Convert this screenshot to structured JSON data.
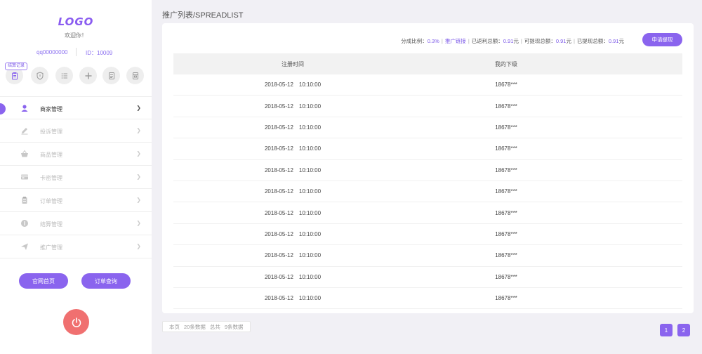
{
  "sidebar": {
    "logo": "LOGO",
    "welcome": "欢迎你！",
    "qq": "qq00000000",
    "uid": "ID：10009",
    "quick_badge": "结算记录",
    "quick_icons": [
      "clipboard-icon",
      "shield-icon",
      "list-icon",
      "plus-icon",
      "document-icon",
      "archive-icon"
    ],
    "menu": [
      {
        "label": "商家管理",
        "icon": "user-icon",
        "active": true
      },
      {
        "label": "投诉管理",
        "icon": "pencil-icon"
      },
      {
        "label": "商品管理",
        "icon": "basket-icon"
      },
      {
        "label": "卡密管理",
        "icon": "card-icon"
      },
      {
        "label": "订单管理",
        "icon": "clipboard-icon"
      },
      {
        "label": "结算管理",
        "icon": "coin-icon"
      },
      {
        "label": "推广管理",
        "icon": "send-icon"
      }
    ],
    "home_button": "官网首页",
    "order_query_button": "订单查询"
  },
  "main": {
    "title": "推广列表/SPREADLIST",
    "stats": {
      "ratio_label": "分成比例：",
      "ratio_value": "0.3%",
      "promo_link": "推广链接",
      "total_rebate_label": "已返利总额：",
      "total_rebate_value": "0.91",
      "withdrawable_label": "可提现总额：",
      "withdrawable_value": "0.91",
      "withdrawn_label": "已提现总额：",
      "withdrawn_value": "0.91",
      "currency": "元"
    },
    "apply_button": "申请提现",
    "table": {
      "headers": [
        "注册时间",
        "我的下级"
      ],
      "rows": [
        {
          "date": "2018-05-12",
          "time": "10:10:00",
          "user": "18678***"
        },
        {
          "date": "2018-05-12",
          "time": "10:10:00",
          "user": "18678***"
        },
        {
          "date": "2018-05-12",
          "time": "10:10:00",
          "user": "18678***"
        },
        {
          "date": "2018-05-12",
          "time": "10:10:00",
          "user": "18678***"
        },
        {
          "date": "2018-05-12",
          "time": "10:10:00",
          "user": "18678***"
        },
        {
          "date": "2018-05-12",
          "time": "10:10:00",
          "user": "18678***"
        },
        {
          "date": "2018-05-12",
          "time": "10:10:00",
          "user": "18678***"
        },
        {
          "date": "2018-05-12",
          "time": "10:10:00",
          "user": "18678***"
        },
        {
          "date": "2018-05-12",
          "time": "10:10:00",
          "user": "18678***"
        },
        {
          "date": "2018-05-12",
          "time": "10:10:00",
          "user": "18678***"
        },
        {
          "date": "2018-05-12",
          "time": "10:10:00",
          "user": "18678***"
        }
      ]
    },
    "pagination": {
      "info": [
        "本页",
        "20条数据",
        "总共",
        "9条数据"
      ],
      "pages": [
        "1",
        "2"
      ]
    }
  },
  "colors": {
    "accent": "#8a64ee",
    "power": "#f07070",
    "background": "#f1f0f5"
  }
}
